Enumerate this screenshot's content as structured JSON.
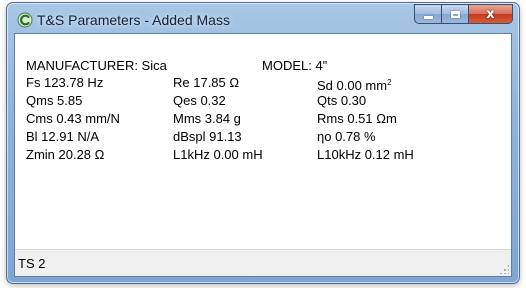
{
  "window": {
    "title": "T&S Parameters - Added Mass",
    "icon": "app-c-icon",
    "caption_buttons": [
      "minimize",
      "maximize",
      "close"
    ],
    "close_glyph": "x"
  },
  "header": {
    "manufacturer": "MANUFACTURER:  Sica",
    "model": "MODEL:  4\""
  },
  "params": {
    "fs": "Fs  123.78 Hz",
    "re": "Re  17.85 Ω",
    "sd_prefix": "Sd  0.00 mm",
    "sd_exp": "2",
    "qms": "Qms 5.85",
    "qes": "Qes 0.32",
    "qts": "Qts 0.30",
    "cms": "Cms 0.43 mm/N",
    "mms": "Mms 3.84 g",
    "rms": "Rms 0.51 Ωm",
    "bl": "Bl  12.91 N/A",
    "dbspl": "dBspl 91.13",
    "eta": "ηo  0.78 %",
    "zmin": "Zmin  20.28 Ω",
    "l1khz": "L1kHz  0.00 mH",
    "l10khz": "L10kHz 0.12 mH"
  },
  "status": {
    "text": "TS 2"
  },
  "colors": {
    "frame": "#8fb3da",
    "close_button": "#c4391c",
    "status_bar": "#f0f0f0"
  }
}
